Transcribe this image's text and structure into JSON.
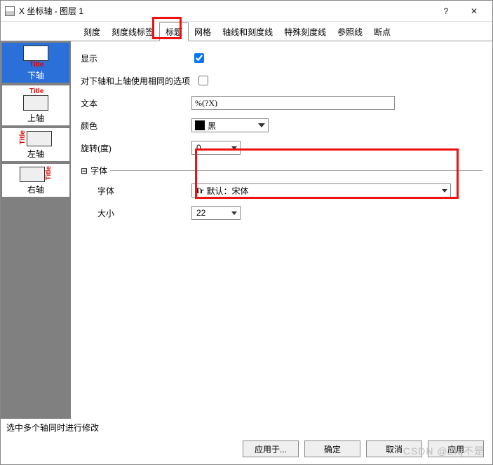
{
  "window": {
    "title": "X 坐标轴 - 图层 1",
    "help": "?",
    "close": "✕"
  },
  "tabs": [
    {
      "id": "scale",
      "label": "刻度"
    },
    {
      "id": "ticklabels",
      "label": "刻度线标签"
    },
    {
      "id": "title",
      "label": "标题"
    },
    {
      "id": "grid",
      "label": "网格"
    },
    {
      "id": "axisline",
      "label": "轴线和刻度线"
    },
    {
      "id": "specialticks",
      "label": "特殊刻度线"
    },
    {
      "id": "reference",
      "label": "参照线"
    },
    {
      "id": "breaks",
      "label": "断点"
    }
  ],
  "active_tab": "标题",
  "sidebar": {
    "items": [
      {
        "name": "下轴",
        "title_pos": "bottom"
      },
      {
        "name": "上轴",
        "title_pos": "top"
      },
      {
        "name": "左轴",
        "title_pos": "left"
      },
      {
        "name": "右轴",
        "title_pos": "right"
      }
    ],
    "title_text": "Title"
  },
  "form": {
    "show_label": "显示",
    "show_checked": true,
    "same_label": "对下轴和上轴使用相同的选项",
    "same_checked": false,
    "text_label": "文本",
    "text_value": "%(?X)",
    "color_label": "颜色",
    "color_value": "黑",
    "rotate_label": "旋转(度)",
    "rotate_value": "0",
    "font_group": "字体",
    "font_label": "字体",
    "font_value": "默认：宋体",
    "font_prefix": "Tr",
    "size_label": "大小",
    "size_value": "22",
    "collapse": "⊟"
  },
  "footer": {
    "hint": "选中多个轴同时进行修改",
    "apply_to": "应用于...",
    "ok": "确定",
    "cancel": "取消",
    "apply": "应用"
  },
  "watermark": "CSDN @Zlq不是"
}
